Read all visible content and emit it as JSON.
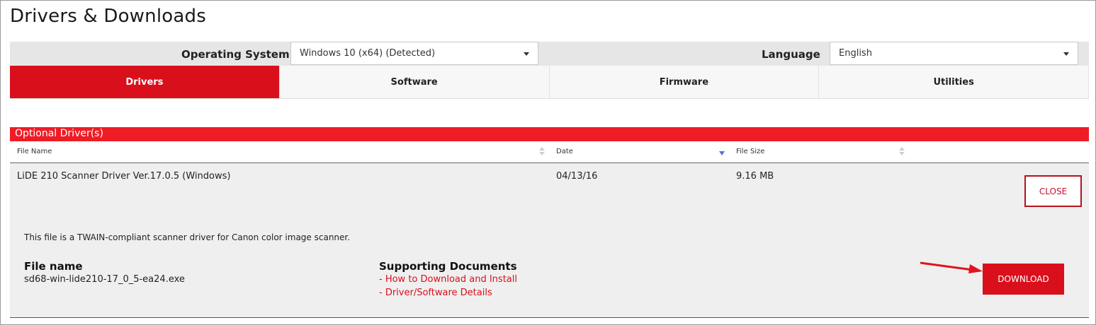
{
  "page": {
    "title": "Drivers & Downloads"
  },
  "selectors": {
    "os_label": "Operating System",
    "os_value": "Windows 10 (x64) (Detected)",
    "language_label": "Language",
    "language_value": "English"
  },
  "tabs": [
    {
      "label": "Drivers",
      "active": true
    },
    {
      "label": "Software",
      "active": false
    },
    {
      "label": "Firmware",
      "active": false
    },
    {
      "label": "Utilities",
      "active": false
    }
  ],
  "section": {
    "title": "Optional Driver(s)",
    "columns": [
      "File Name",
      "Date",
      "File Size"
    ]
  },
  "row": {
    "file_title": "LiDE 210 Scanner Driver Ver.17.0.5 (Windows)",
    "date": "04/13/16",
    "size": "9.16 MB",
    "close_label": "CLOSE",
    "description": "This file is a TWAIN-compliant scanner driver for Canon color image scanner.",
    "file_name_label": "File name",
    "file_name": "sd68-win-lide210-17_0_5-ea24.exe",
    "docs_label": "Supporting Documents",
    "docs": [
      "- How to Download and Install",
      "- Driver/Software Details"
    ],
    "download_label": "DOWNLOAD"
  },
  "colors": {
    "brand_red": "#d9101b",
    "section_red": "#ee1c25",
    "sort_active": "#5a6fd0"
  }
}
